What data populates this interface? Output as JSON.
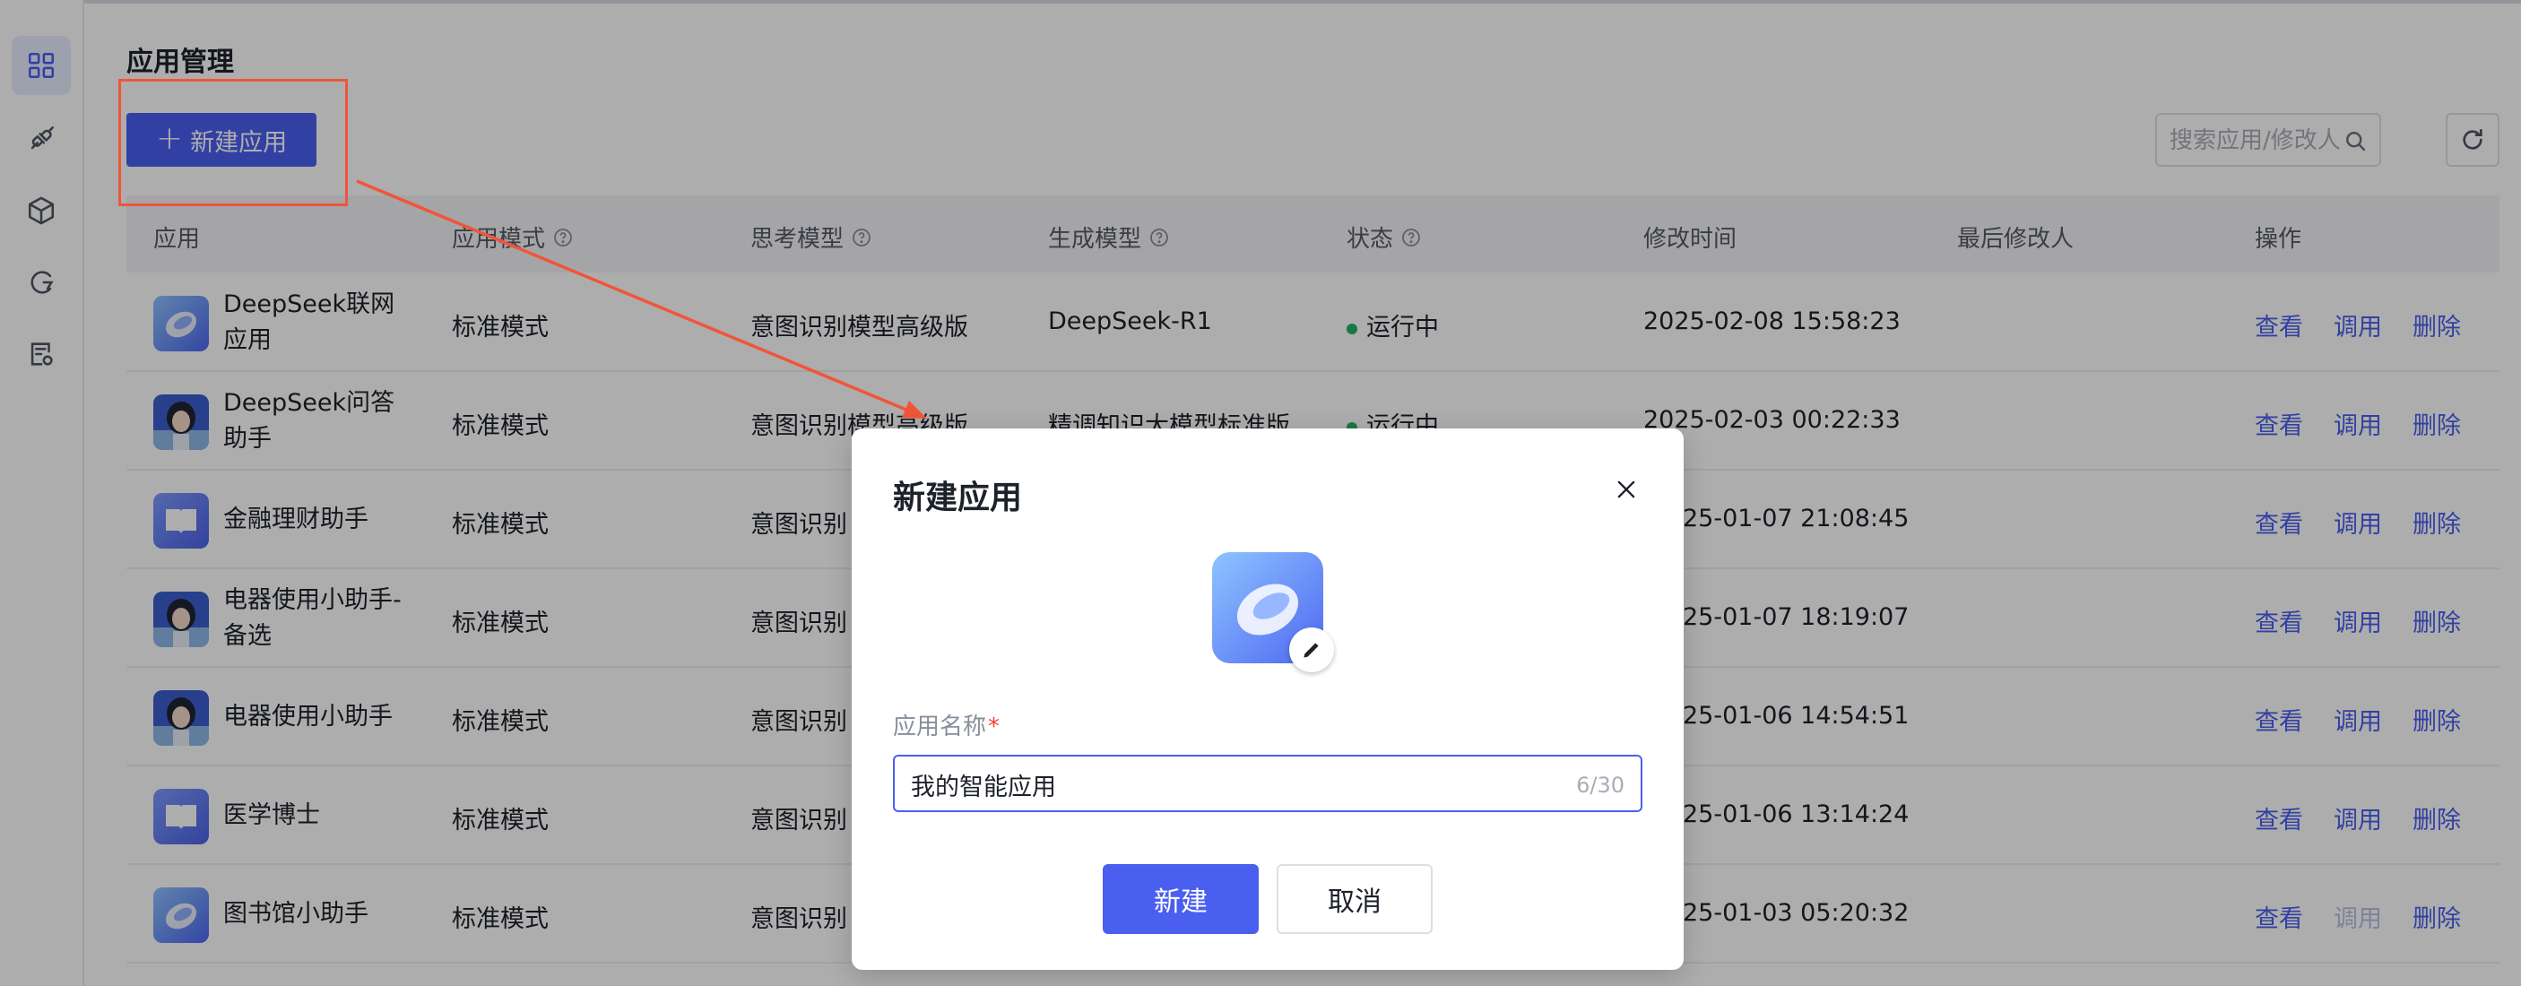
{
  "page": {
    "title": "应用管理",
    "new_button_label": "新建应用",
    "search_placeholder": "搜索应用/修改人"
  },
  "sidebar": {
    "items": [
      {
        "icon": "grid-icon",
        "active": true
      },
      {
        "icon": "plugin-icon",
        "active": false
      },
      {
        "icon": "cube-icon",
        "active": false
      },
      {
        "icon": "knowledge-icon",
        "active": false
      },
      {
        "icon": "doc-settings-icon",
        "active": false
      }
    ]
  },
  "table": {
    "columns": [
      "应用",
      "应用模式",
      "思考模型",
      "生成模型",
      "状态",
      "修改时间",
      "最后修改人",
      "操作"
    ],
    "rows": [
      {
        "name": "DeepSeek联网应用",
        "avatar": "logo",
        "mode": "标准模式",
        "think_model": "意图识别模型高级版",
        "gen_model": "DeepSeek-R1",
        "status": "运行中",
        "time": "2025-02-08 15:58:23",
        "modifier": "",
        "ops": [
          "查看",
          "调用",
          "删除"
        ]
      },
      {
        "name": "DeepSeek问答助手",
        "avatar": "person",
        "mode": "标准模式",
        "think_model": "意图识别模型高级版",
        "gen_model": "精调知识大模型标准版",
        "status": "运行中",
        "time": "2025-02-03 00:22:33",
        "modifier": "",
        "ops": [
          "查看",
          "调用",
          "删除"
        ]
      },
      {
        "name": "金融理财助手",
        "avatar": "book",
        "mode": "标准模式",
        "think_model": "意图识别",
        "gen_model": "",
        "status": "",
        "time": "25-01-07 21:08:45",
        "modifier": "",
        "ops": [
          "查看",
          "调用",
          "删除"
        ]
      },
      {
        "name": "电器使用小助手-备选",
        "avatar": "person",
        "mode": "标准模式",
        "think_model": "意图识别",
        "gen_model": "",
        "status": "",
        "time": "25-01-07 18:19:07",
        "modifier": "",
        "ops": [
          "查看",
          "调用",
          "删除"
        ]
      },
      {
        "name": "电器使用小助手",
        "avatar": "person",
        "mode": "标准模式",
        "think_model": "意图识别",
        "gen_model": "",
        "status": "",
        "time": "25-01-06 14:54:51",
        "modifier": "",
        "ops": [
          "查看",
          "调用",
          "删除"
        ]
      },
      {
        "name": "医学博士",
        "avatar": "book",
        "mode": "标准模式",
        "think_model": "意图识别",
        "gen_model": "",
        "status": "",
        "time": "25-01-06 13:14:24",
        "modifier": "",
        "ops": [
          "查看",
          "调用",
          "删除"
        ]
      },
      {
        "name": "图书馆小助手",
        "avatar": "logo",
        "mode": "标准模式",
        "think_model": "意图识别",
        "gen_model": "",
        "status": "",
        "time": "25-01-03 05:20:32",
        "modifier": "",
        "ops": [
          "查看",
          "调用",
          "删除"
        ],
        "invoke_disabled": true
      }
    ]
  },
  "modal": {
    "title": "新建应用",
    "field_label": "应用名称",
    "required_mark": "*",
    "name_value": "我的智能应用",
    "counter": "6/30",
    "confirm_label": "新建",
    "cancel_label": "取消"
  },
  "colors": {
    "primary": "#4a5ff0",
    "status_running": "#22b35e",
    "annotation": "#f0553a"
  }
}
